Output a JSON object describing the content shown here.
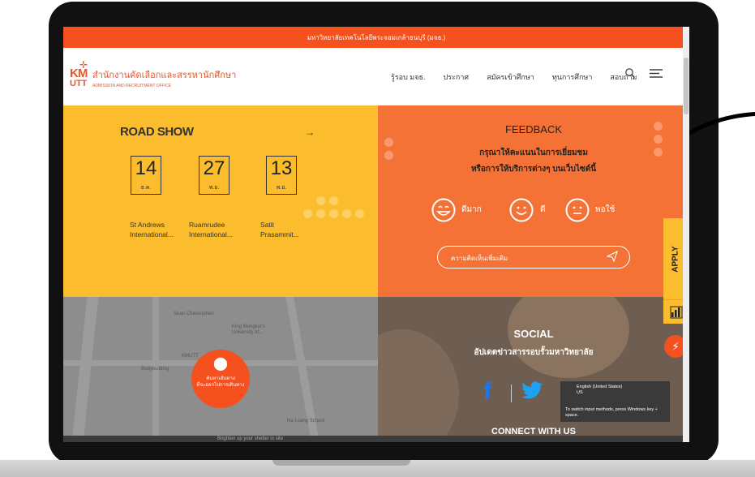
{
  "topbar": {
    "text": "มหาวิทยาลัยเทคโนโลยีพระจอมเกล้าธนบุรี (มจธ.)"
  },
  "logo": {
    "mark_km": "KM",
    "mark_utt": "UTT",
    "title_th": "สำนักงานคัดเลือกและสรรหานักศึกษา",
    "title_en": "ADMISSION AND RECRUITMENT OFFICE"
  },
  "nav": {
    "items": [
      {
        "label": "รู้รอบ มจธ."
      },
      {
        "label": "ประกาศ"
      },
      {
        "label": "สมัครเข้าศึกษา"
      },
      {
        "label": "ทุนการศึกษา"
      },
      {
        "label": "สอบถาม"
      }
    ],
    "search_icon": "search-icon",
    "menu_icon": "hamburger-icon"
  },
  "roadshow": {
    "title": "ROAD SHOW",
    "arrow": "→",
    "events": [
      {
        "day": "14",
        "month": "ธ.ค.",
        "venue_line1": "St Andrews",
        "venue_line2": "International..."
      },
      {
        "day": "27",
        "month": "พ.ย.",
        "venue_line1": "Ruamrudee",
        "venue_line2": "International..."
      },
      {
        "day": "13",
        "month": "พ.ย.",
        "venue_line1": "Satit",
        "venue_line2": "Prasammit..."
      }
    ]
  },
  "feedback": {
    "title": "FEEDBACK",
    "line1": "กรุณาให้คะแนนในการเยี่ยมชม",
    "line2": "หรือการให้บริการต่างๆ บนเว็บไซต์นี้",
    "ratings": [
      {
        "label": "ดีมาก",
        "icon": "very-happy-face-icon"
      },
      {
        "label": "ดี",
        "icon": "smile-face-icon"
      },
      {
        "label": "พอใช้",
        "icon": "neutral-face-icon"
      }
    ],
    "comment_placeholder": "ความคิดเห็นเพิ่มเติม",
    "send_icon": "send-icon"
  },
  "map": {
    "labels": [
      "Suan Chaosophon",
      "King Mongkut's University of...",
      "KMUTT",
      "Na Luang School",
      "Bodybuilding"
    ],
    "pin_text_line1": "ค้นหาเส้นทาง",
    "pin_text_line2": "ที่จะออกไปการเดินทาง"
  },
  "social": {
    "title": "SOCIAL",
    "subtitle": "อัปเดตข่าวสารรอบรั้วมหาวิทยาลัย",
    "connect": "CONNECT WITH US"
  },
  "ime_popup": {
    "lang": "English (United States)",
    "code": "US",
    "hint": "To switch input methods, press Windows key + space."
  },
  "side": {
    "apply_label": "APPLY"
  },
  "taskbar": {
    "text": "Brighten up your shelter in site"
  },
  "colors": {
    "orange": "#f57236",
    "yellow": "#fbbd2d",
    "red": "#f4511e"
  }
}
